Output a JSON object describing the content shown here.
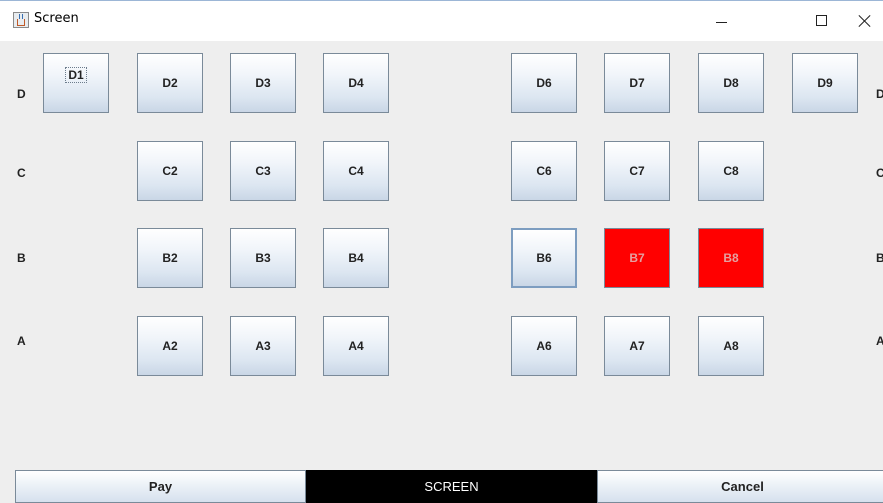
{
  "window": {
    "title": "Screen",
    "icon": "java-cup-icon",
    "controls": [
      "minimize-icon",
      "maximize-icon",
      "close-icon"
    ]
  },
  "rows": {
    "left": [
      "D",
      "C",
      "B",
      "A"
    ],
    "right": [
      "D",
      "C",
      "B",
      "A"
    ]
  },
  "seats": {
    "D1": "D1",
    "D2": "D2",
    "D3": "D3",
    "D4": "D4",
    "D6": "D6",
    "D7": "D7",
    "D8": "D8",
    "D9": "D9",
    "C2": "C2",
    "C3": "C3",
    "C4": "C4",
    "C6": "C6",
    "C7": "C7",
    "C8": "C8",
    "B2": "B2",
    "B3": "B3",
    "B4": "B4",
    "B6": "B6",
    "B7": "B7",
    "B8": "B8",
    "A2": "A2",
    "A3": "A3",
    "A4": "A4",
    "A6": "A6",
    "A7": "A7",
    "A8": "A8"
  },
  "booked_seats": [
    "B7",
    "B8"
  ],
  "booked_color": "#ff0000",
  "bottom": {
    "pay_label": "Pay",
    "screen_label": "SCREEN",
    "cancel_label": "Cancel"
  }
}
